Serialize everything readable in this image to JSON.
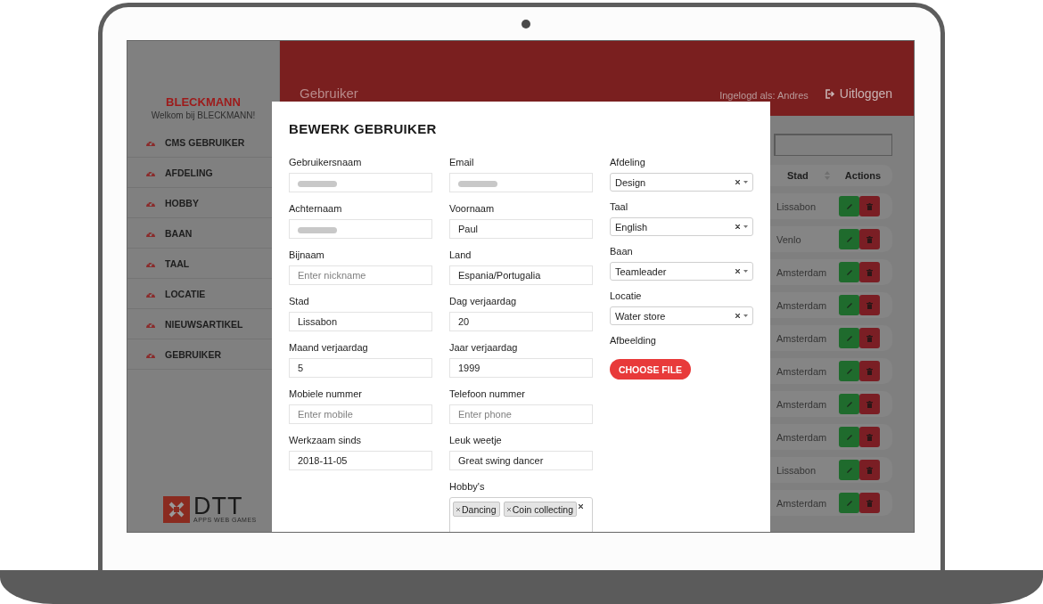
{
  "sidebar": {
    "brand": "BLECKMANN",
    "welcome": "Welkom bij BLECKMANN!",
    "items": [
      "CMS GEBRUIKER",
      "AFDELING",
      "HOBBY",
      "BAAN",
      "TAAL",
      "LOCATIE",
      "NIEUWSARTIKEL",
      "GEBRUIKER"
    ],
    "logo": {
      "name": "DTT",
      "tagline": "APPS WEB GAMES"
    }
  },
  "header": {
    "page_title": "Gebruiker",
    "logged_in": "Ingelogd als: Andres",
    "logout": "Uitloggen"
  },
  "table": {
    "columns": [
      "Stad",
      "Actions"
    ],
    "rows": [
      {
        "stad": "Lissabon"
      },
      {
        "stad": "Venlo"
      },
      {
        "stad": "Amsterdam"
      },
      {
        "stad": "Amsterdam"
      },
      {
        "stad": "Amsterdam"
      },
      {
        "stad": "Amsterdam"
      },
      {
        "stad": "Amsterdam"
      },
      {
        "stad": "Amsterdam"
      },
      {
        "stad": "Lissabon"
      },
      {
        "stad": "Amsterdam"
      }
    ]
  },
  "modal": {
    "title": "BEWERK GEBRUIKER",
    "columns": [
      [
        {
          "kind": "text",
          "label": "Gebruikersnaam",
          "redacted": true
        },
        {
          "kind": "text",
          "label": "Achternaam",
          "redacted": true
        },
        {
          "kind": "text",
          "label": "Bijnaam",
          "placeholder": "Enter nickname"
        },
        {
          "kind": "text",
          "label": "Stad",
          "value": "Lissabon"
        },
        {
          "kind": "text",
          "label": "Maand verjaardag",
          "value": "5"
        },
        {
          "kind": "text",
          "label": "Mobiele nummer",
          "placeholder": "Enter mobile"
        },
        {
          "kind": "text",
          "label": "Werkzaam sinds",
          "value": "2018-11-05"
        }
      ],
      [
        {
          "kind": "text",
          "label": "Email",
          "redacted": true
        },
        {
          "kind": "text",
          "label": "Voornaam",
          "value": "Paul"
        },
        {
          "kind": "text",
          "label": "Land",
          "value": "Espania/Portugalia"
        },
        {
          "kind": "text",
          "label": "Dag verjaardag",
          "value": "20"
        },
        {
          "kind": "text",
          "label": "Jaar verjaardag",
          "value": "1999"
        },
        {
          "kind": "text",
          "label": "Telefoon nummer",
          "placeholder": "Enter phone"
        },
        {
          "kind": "text",
          "label": "Leuk weetje",
          "value": "Great swing dancer"
        },
        {
          "kind": "tags",
          "label": "Hobby's",
          "tags": [
            "Dancing",
            "Coin collecting"
          ]
        }
      ],
      [
        {
          "kind": "select",
          "label": "Afdeling",
          "value": "Design"
        },
        {
          "kind": "select",
          "label": "Taal",
          "value": "English"
        },
        {
          "kind": "select",
          "label": "Baan",
          "value": "Teamleader"
        },
        {
          "kind": "select",
          "label": "Locatie",
          "value": "Water store"
        },
        {
          "kind": "file",
          "label": "Afbeelding",
          "button": "CHOOSE FILE"
        }
      ]
    ]
  }
}
